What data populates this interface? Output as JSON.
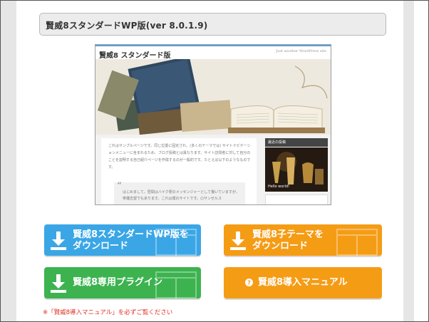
{
  "page": {
    "heading": "賢威8スタンダードWP版(ver 8.0.1.9)"
  },
  "preview": {
    "site_title": "賢威8 スタンダード版",
    "tagline": "Just another WordPress site",
    "body_text": "これはサンプルページです。同じ位置に固定され、(多くのテーマでは) サイトナビゲーションメニューに含まれるため、ブログ投稿とは異なります。サイト訪問者に対して自分のことを説明する自己紹介ページを作成するのが一般的です。たとえば以下のようなものです。",
    "quote_mark": "“",
    "quote_text": "はじめまして。昼間はバイク便のメッセンジャーとして働いていますが、俳優志望でもあります。これは僕のサイトです。ロサンゼルス",
    "widget_title": "最近の投稿",
    "widget_caption": "Hello world!"
  },
  "buttons": {
    "standard_download": "賢威8スタンダードWP版を\nダウンロード",
    "child_theme_download": "賢威8子テーマを\nダウンロード",
    "plugin": "賢威8専用プラグイン",
    "manual": "賢威8導入マニュアル"
  },
  "colors": {
    "blue": "#3aa6e6",
    "orange": "#f59c15",
    "green": "#3cb34f",
    "note_red": "#e03020"
  },
  "icons": {
    "download": "download-icon",
    "manual": "question-circle-icon"
  },
  "note": "※「賢威8導入マニュアル」を必ずご覧ください"
}
